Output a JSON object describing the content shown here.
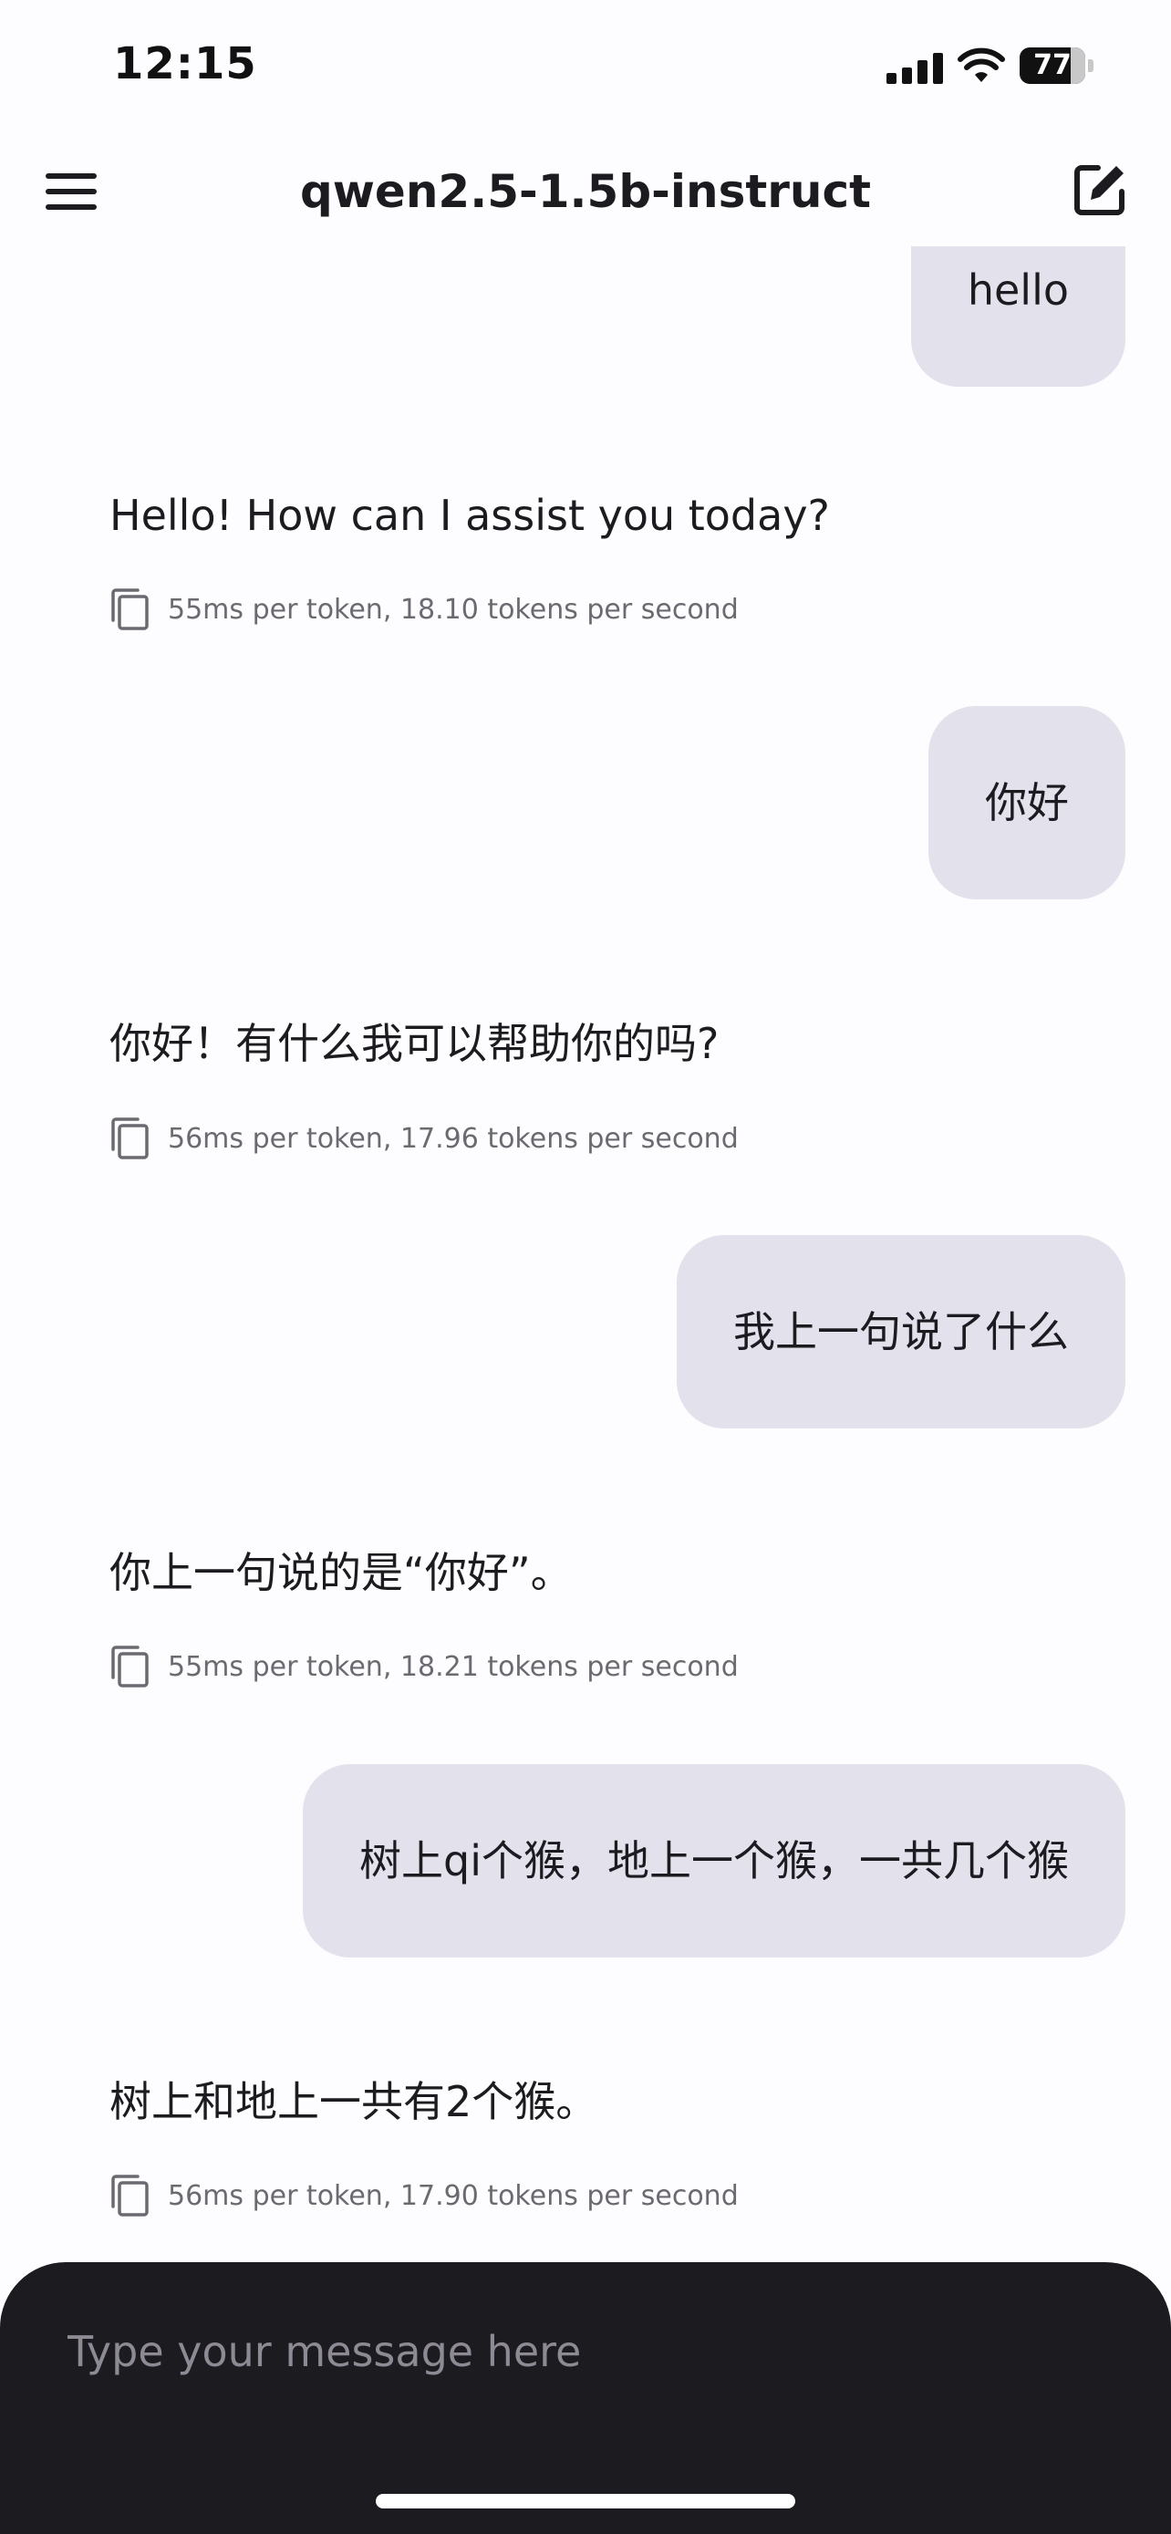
{
  "status_bar": {
    "time": "12:15",
    "battery_level": "77"
  },
  "app_bar": {
    "title": "qwen2.5-1.5b-instruct",
    "menu_icon": "hamburger-menu-icon",
    "new_chat_icon": "edit-square-icon"
  },
  "messages": [
    {
      "role": "user",
      "text": "hello"
    },
    {
      "role": "assistant",
      "text": "Hello! How can I assist you today?",
      "stats": "55ms per token, 18.10 tokens per second"
    },
    {
      "role": "user",
      "text": "你好"
    },
    {
      "role": "assistant",
      "text": "你好！有什么我可以帮助你的吗?",
      "stats": "56ms per token, 17.96 tokens per second"
    },
    {
      "role": "user",
      "text": "我上一句说了什么"
    },
    {
      "role": "assistant",
      "text": "你上一句说的是“你好”。",
      "stats": "55ms per token, 18.21 tokens per second"
    },
    {
      "role": "user",
      "text": "树上qi个猴，地上一个猴，一共几个猴"
    },
    {
      "role": "assistant",
      "text": "树上和地上一共有2个猴。",
      "stats": "56ms per token, 17.90 tokens per second"
    }
  ],
  "input": {
    "placeholder": "Type your message here",
    "value": ""
  },
  "colors": {
    "background": "#fdfcff",
    "user_bubble": "#e3e1ec",
    "input_panel": "#1c1b20"
  }
}
